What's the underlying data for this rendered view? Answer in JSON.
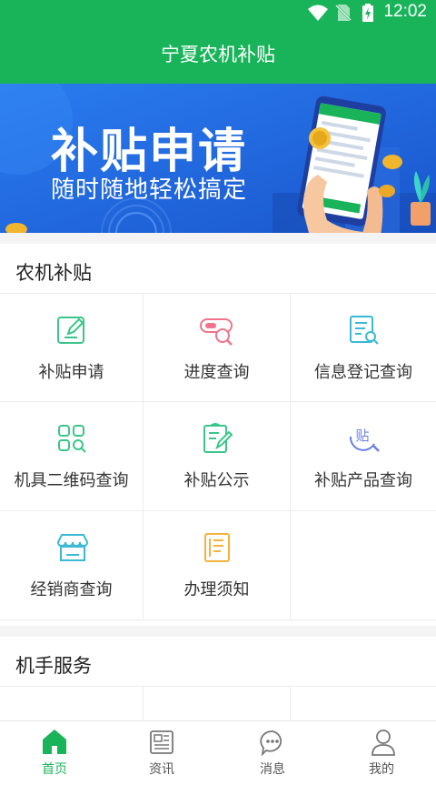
{
  "status_bar": {
    "time": "12:02",
    "icons": [
      "wifi-icon",
      "no-sim-icon",
      "battery-charging-icon"
    ]
  },
  "app": {
    "title": "宁夏农机补贴"
  },
  "banner": {
    "title": "补贴申请",
    "subtitle": "随时随地轻松搞定"
  },
  "section1": {
    "title": "农机补贴",
    "items": [
      {
        "label": "补贴申请",
        "icon": "edit-icon"
      },
      {
        "label": "进度查询",
        "icon": "progress-search-icon"
      },
      {
        "label": "信息登记查询",
        "icon": "document-search-icon"
      },
      {
        "label": "机具二维码查询",
        "icon": "qr-grid-icon"
      },
      {
        "label": "补贴公示",
        "icon": "clipboard-pen-icon"
      },
      {
        "label": "补贴产品查询",
        "icon": "subsidy-search-icon"
      },
      {
        "label": "经销商查询",
        "icon": "store-icon"
      },
      {
        "label": "办理须知",
        "icon": "notice-doc-icon"
      }
    ]
  },
  "section2": {
    "title": "机手服务",
    "items": [
      {
        "icon": "handshake-icon"
      },
      {
        "icon": "card-icon"
      },
      {
        "icon": "tractor-icon"
      }
    ]
  },
  "tabs": [
    {
      "label": "首页",
      "icon": "home-icon",
      "active": true
    },
    {
      "label": "资讯",
      "icon": "news-icon",
      "active": false
    },
    {
      "label": "消息",
      "icon": "chat-icon",
      "active": false
    },
    {
      "label": "我的",
      "icon": "user-icon",
      "active": false
    }
  ],
  "colors": {
    "primary": "#19b45a",
    "banner_bg": "#1f6fe0"
  }
}
